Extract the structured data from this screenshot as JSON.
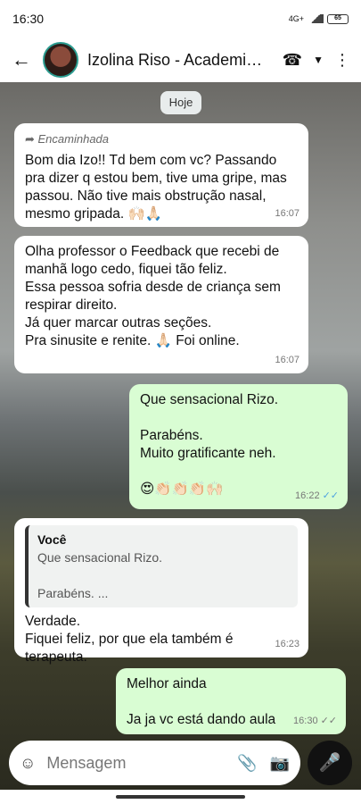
{
  "status": {
    "time": "16:30",
    "network": "4G+",
    "battery": "65"
  },
  "header": {
    "contact_name": "Izolina Riso - Academia..."
  },
  "chat": {
    "date_chip": "Hoje",
    "messages": [
      {
        "forwarded_label": "Encaminhada",
        "text": "Bom dia Izo!! Td bem com vc? Passando pra dizer q estou bem, tive uma gripe, mas passou. Não tive mais obstrução nasal, mesmo gripada. 🙌🏻🙏🏻",
        "time": "16:07"
      },
      {
        "text": "Olha professor o Feedback  que recebi  de manhã  logo cedo, fiquei tão  feliz.\nEssa pessoa  sofria desde de criança sem  respirar direito.\nJá  quer marcar outras seções.\nPra sinusite  e renite.  🙏🏻  Foi online.",
        "time": "16:07"
      },
      {
        "text": "Que sensacional Rizo.\n\nParabéns.\nMuito gratificante neh.\n\n😍👏🏻👏🏻👏🏻🙌🏻",
        "time": "16:22"
      },
      {
        "quote_author": "Você",
        "quote_text": "Que sensacional Rizo.\n\nParabéns. ...",
        "text": "Verdade.\n Fiquei  feliz, por que ela também  é terapeuta.",
        "time": "16:23"
      },
      {
        "text": "Melhor ainda\n\nJa ja vc está dando aula",
        "time": "16:30"
      }
    ]
  },
  "composer": {
    "placeholder": "Mensagem"
  }
}
